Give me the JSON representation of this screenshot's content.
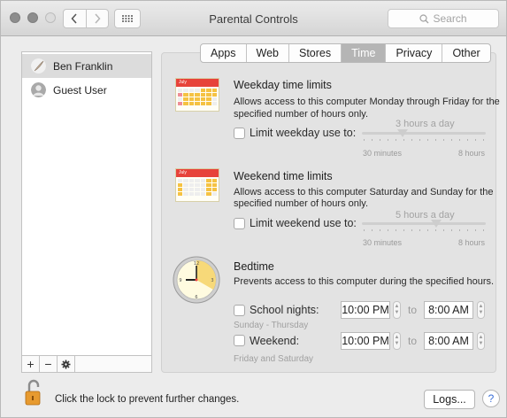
{
  "window": {
    "title": "Parental Controls",
    "search_placeholder": "Search",
    "nav_back_icon": "chevron-left",
    "nav_forward_icon": "chevron-right",
    "grid_icon": "grid"
  },
  "sidebar": {
    "users": [
      {
        "name": "Ben Franklin",
        "selected": true,
        "avatar": "feather-avatar"
      },
      {
        "name": "Guest User",
        "selected": false,
        "avatar": "generic-avatar"
      }
    ],
    "footer": {
      "add": "+",
      "remove": "−",
      "action": "✱"
    }
  },
  "tabs": [
    {
      "label": "Apps",
      "active": false
    },
    {
      "label": "Web",
      "active": false
    },
    {
      "label": "Stores",
      "active": false
    },
    {
      "label": "Time",
      "active": true
    },
    {
      "label": "Privacy",
      "active": false
    },
    {
      "label": "Other",
      "active": false
    }
  ],
  "weekday": {
    "title": "Weekday time limits",
    "desc_line1": "Allows access to this computer Monday through Friday for the",
    "desc_line2": "specified number of hours only.",
    "checkbox_label": "Limit weekday use to:",
    "checked": false,
    "slider_value": "3 hours a day",
    "slider_fraction": 0.33,
    "min_label": "30 minutes",
    "max_label": "8 hours",
    "calendar_month": "July"
  },
  "weekend": {
    "title": "Weekend time limits",
    "desc_line1": "Allows access to this computer Saturday and Sunday for the",
    "desc_line2": "specified number of hours only.",
    "checkbox_label": "Limit weekend use to:",
    "checked": false,
    "slider_value": "5 hours a day",
    "slider_fraction": 0.6,
    "min_label": "30 minutes",
    "max_label": "8 hours",
    "calendar_month": "July"
  },
  "bedtime": {
    "title": "Bedtime",
    "desc": "Prevents access to this computer during the specified hours.",
    "school_nights": {
      "label": "School nights:",
      "sub": "Sunday - Thursday",
      "from": "10:00 PM",
      "to": "8:00 AM",
      "checked": false
    },
    "weekend": {
      "label": "Weekend:",
      "sub": "Friday and Saturday",
      "from": "10:00 PM",
      "to": "8:00 AM",
      "checked": false
    },
    "to_label": "to"
  },
  "footer": {
    "lock_text": "Click the lock to prevent further changes.",
    "logs_label": "Logs...",
    "help_label": "?"
  }
}
